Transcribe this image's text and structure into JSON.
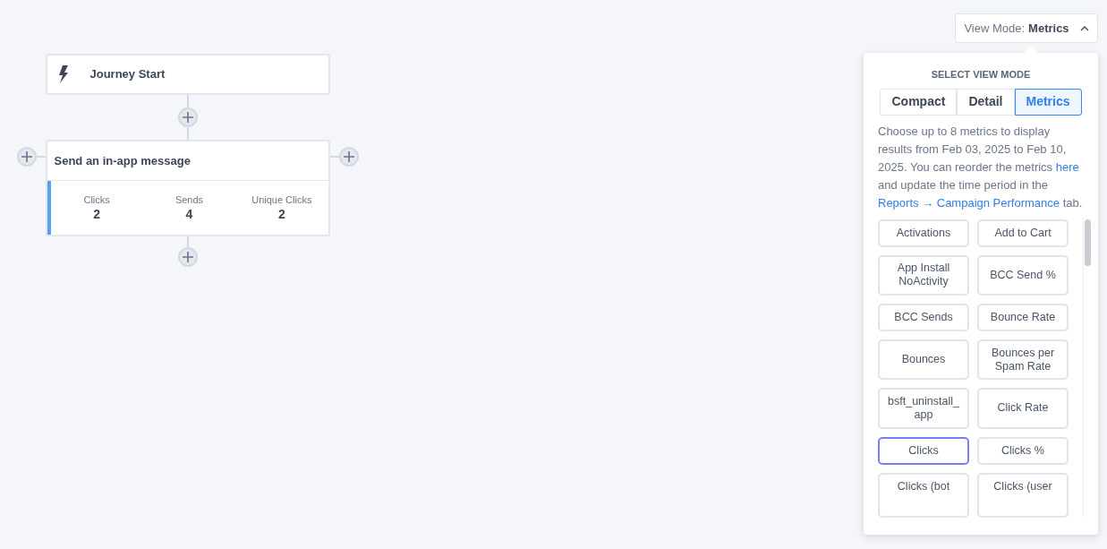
{
  "canvas": {
    "nodes": [
      {
        "kind": "start",
        "title": "Journey Start"
      },
      {
        "kind": "message",
        "title": "Send an in-app message",
        "metrics": [
          {
            "label": "Clicks",
            "value": "2"
          },
          {
            "label": "Sends",
            "value": "4"
          },
          {
            "label": "Unique Clicks",
            "value": "2"
          }
        ]
      }
    ]
  },
  "view_mode_button": {
    "label": "View Mode:",
    "value": "Metrics",
    "expanded": true
  },
  "popover": {
    "heading": "SELECT VIEW MODE",
    "modes": [
      {
        "label": "Compact",
        "selected": false
      },
      {
        "label": "Detail",
        "selected": false
      },
      {
        "label": "Metrics",
        "selected": true
      }
    ],
    "description": {
      "text": "Choose up to 8 metrics to display results from Feb 03, 2025 to Feb 10, 2025. You can reorder the metrics",
      "link1": "here",
      "middle": "and update the time period in the",
      "link2": "Reports → Campaign Performance",
      "end": "tab."
    },
    "metrics": [
      {
        "label": "Activations",
        "selected": false
      },
      {
        "label": "Add to Cart",
        "selected": false
      },
      {
        "label": "App Install NoActivity",
        "selected": false
      },
      {
        "label": "BCC Send %",
        "selected": false
      },
      {
        "label": "BCC Sends",
        "selected": false
      },
      {
        "label": "Bounce Rate",
        "selected": false
      },
      {
        "label": "Bounces",
        "selected": false
      },
      {
        "label": "Bounces per Spam Rate",
        "selected": false
      },
      {
        "label": "bsft_uninstall_ app",
        "selected": false
      },
      {
        "label": "Click Rate",
        "selected": false
      },
      {
        "label": "Clicks",
        "selected": true
      },
      {
        "label": "Clicks %",
        "selected": false
      },
      {
        "label": "Clicks (bot",
        "selected": false
      },
      {
        "label": "Clicks (user",
        "selected": false
      }
    ]
  }
}
